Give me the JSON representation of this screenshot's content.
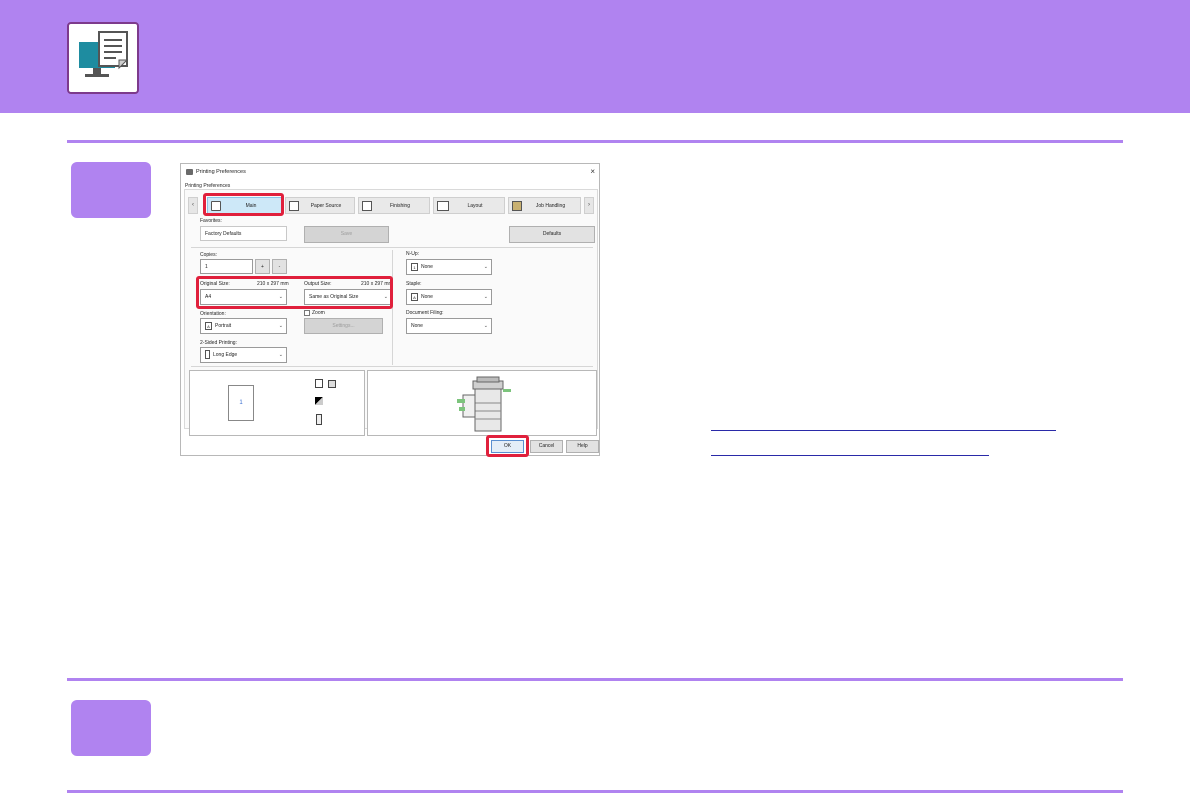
{
  "dialog": {
    "title": "Printing Preferences",
    "tab_header": "Printing Preferences",
    "tabs": [
      {
        "label": "Main"
      },
      {
        "label": "Paper Source"
      },
      {
        "label": "Finishing"
      },
      {
        "label": "Layout"
      },
      {
        "label": "Job Handling"
      }
    ],
    "tab_arrow_left": "‹",
    "tab_arrow_right": "›",
    "favorites_label": "Favorites:",
    "favorites_value": "Factory Defaults",
    "save_label": "Save",
    "defaults_label": "Defaults",
    "copies_label": "Copies:",
    "copies_value": "1",
    "copies_plus": "+",
    "copies_minus": "-",
    "original_size_label": "Original Size:",
    "original_size_dims": "210 x 297 mm",
    "original_size_value": "A4",
    "output_size_label": "Output Size:",
    "output_size_dims": "210 x 297 mm",
    "output_size_value": "Same as Original Size",
    "orientation_label": "Orientation:",
    "orientation_value": "Portrait",
    "orientation_icon": "A",
    "zoom_label": "Zoom",
    "settings_label": "Settings...",
    "two_sided_label": "2-Sided Printing:",
    "two_sided_value": "Long Edge",
    "nup_label": "N-Up:",
    "nup_value": "None",
    "nup_icon": "1",
    "staple_label": "Staple:",
    "staple_value": "None",
    "staple_icon": "A",
    "document_filing_label": "Document Filing:",
    "document_filing_value": "None",
    "preview_page_number": "1",
    "ok_label": "OK",
    "cancel_label": "Cancel",
    "help_label": "Help",
    "close_icon": "×",
    "chevron": "⌄"
  },
  "colors": {
    "accent": "#b083f0",
    "highlight": "#e0203c",
    "link": "#2a2aa8",
    "active_tab": "#cde8f8"
  }
}
